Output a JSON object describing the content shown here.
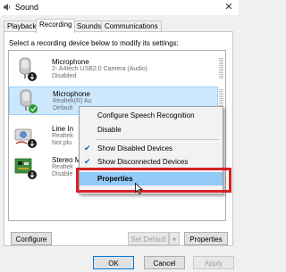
{
  "window": {
    "title": "Sound"
  },
  "tabs": [
    {
      "label": "Playback"
    },
    {
      "label": "Recording"
    },
    {
      "label": "Sounds"
    },
    {
      "label": "Communications"
    }
  ],
  "instruction": "Select a recording device below to modify its settings:",
  "devices": [
    {
      "name": "Microphone",
      "lines": [
        "2- A4tech USB2.0 Camera (Audio)",
        "Disabled"
      ],
      "status_icon": "arrow-down-icon"
    },
    {
      "name": "Microphone",
      "lines": [
        "Realtek(R) Au",
        "Default"
      ],
      "status_icon": "check-icon",
      "selected": true
    },
    {
      "name": "Line In",
      "lines": [
        "Realtek",
        "Not plu"
      ],
      "status_icon": "arrow-down-icon"
    },
    {
      "name": "Stereo M",
      "lines": [
        "Realtek",
        "Disable"
      ],
      "status_icon": "arrow-down-icon"
    }
  ],
  "context_menu": {
    "items": [
      {
        "label": "Configure Speech Recognition",
        "checked": false
      },
      {
        "label": "Disable",
        "checked": false
      },
      {
        "label": "Show Disabled Devices",
        "checked": true
      },
      {
        "label": "Show Disconnected Devices",
        "checked": true
      },
      {
        "label": "Properties",
        "checked": false,
        "highlighted": true
      }
    ]
  },
  "buttons": {
    "configure": "Configure",
    "set_default": "Set Default",
    "set_default_arrow": "▾",
    "properties": "Properties",
    "ok": "OK",
    "cancel": "Cancel",
    "apply": "Apply"
  },
  "colors": {
    "accent": "#0078d7",
    "highlight_border": "#d72127",
    "menu_selected": "#91c9f7",
    "status_green": "#2e9b2e"
  }
}
